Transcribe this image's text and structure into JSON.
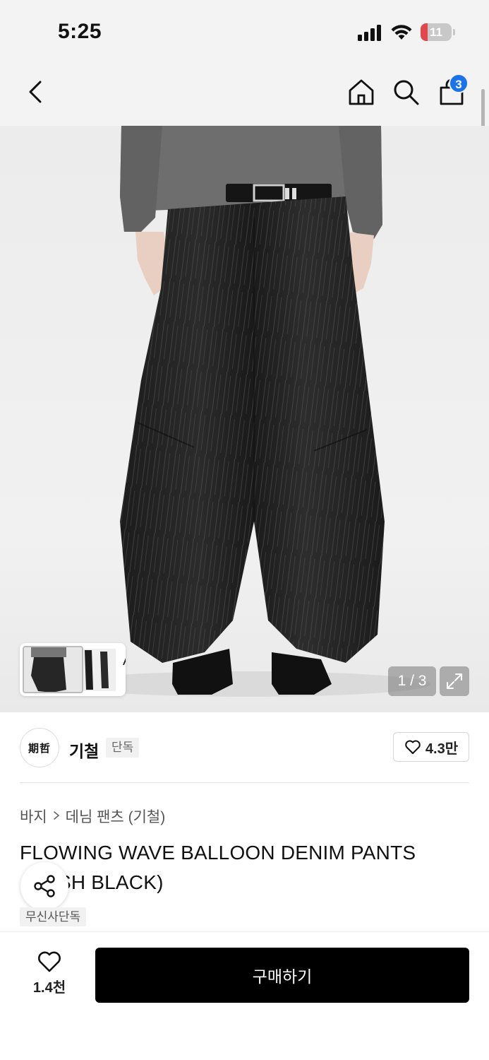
{
  "status_bar": {
    "time": "5:25",
    "battery_level": "11",
    "battery_color": "#e2464b",
    "icons": [
      "signal-icon",
      "wifi-icon",
      "battery-icon"
    ]
  },
  "nav": {
    "icons": [
      "back-icon",
      "home-icon",
      "search-icon",
      "shopping-bag-icon"
    ],
    "cart_count": "3",
    "badge_color": "#1a73e8"
  },
  "gallery": {
    "counter": "1 / 3",
    "ai_label": "AI",
    "icons": [
      "expand-icon",
      "chevron-right-icon"
    ]
  },
  "brand": {
    "logo_text": "期哲",
    "name": "기철",
    "tag": "단독",
    "likes": "4.3만"
  },
  "breadcrumb": {
    "category": "바지",
    "subcategory": "데님 팬츠 (기철)"
  },
  "product": {
    "title": "FLOWING WAVE BALLOON DENIM PANTS (WASH BLACK)",
    "exclusive_tag": "무신사단독"
  },
  "bottom_bar": {
    "wish_count": "1.4천",
    "buy_label": "구매하기",
    "buy_color": "#000000"
  }
}
